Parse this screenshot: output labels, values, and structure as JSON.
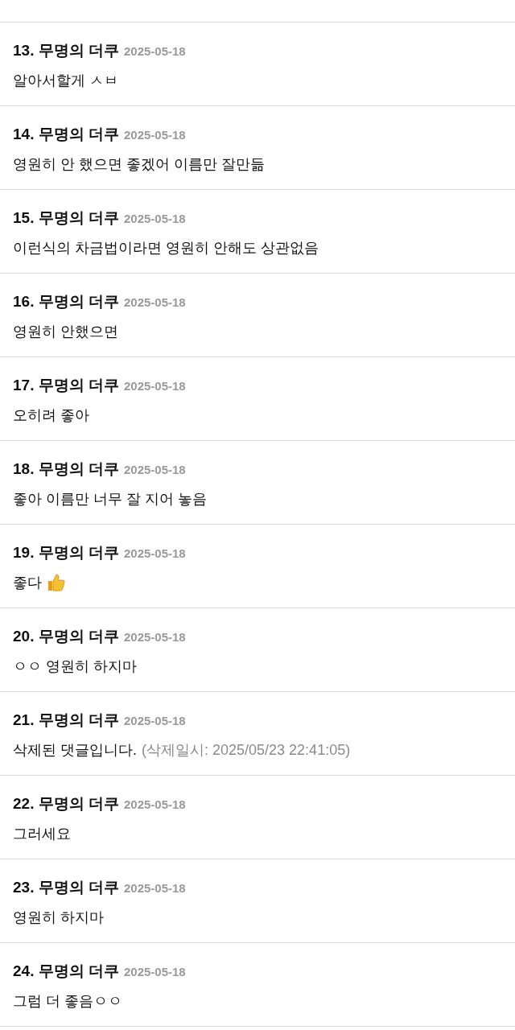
{
  "comments": [
    {
      "number": "13.",
      "author": "무명의 더쿠",
      "date": "2025-05-18",
      "text": "알아서할게 ㅅㅂ"
    },
    {
      "number": "14.",
      "author": "무명의 더쿠",
      "date": "2025-05-18",
      "text": "영원히 안 했으면 좋겠어 이름만 잘만듦"
    },
    {
      "number": "15.",
      "author": "무명의 더쿠",
      "date": "2025-05-18",
      "text": "이런식의 차금법이라면 영원히 안해도 상관없음"
    },
    {
      "number": "16.",
      "author": "무명의 더쿠",
      "date": "2025-05-18",
      "text": "영원히 안했으면"
    },
    {
      "number": "17.",
      "author": "무명의 더쿠",
      "date": "2025-05-18",
      "text": "오히려 좋아"
    },
    {
      "number": "18.",
      "author": "무명의 더쿠",
      "date": "2025-05-18",
      "text": "좋아 이름만 너무 잘 지어 놓음"
    },
    {
      "number": "19.",
      "author": "무명의 더쿠",
      "date": "2025-05-18",
      "text": "좋다",
      "thumbs_up": true
    },
    {
      "number": "20.",
      "author": "무명의 더쿠",
      "date": "2025-05-18",
      "text": "ㅇㅇ 영원히 하지마"
    },
    {
      "number": "21.",
      "author": "무명의 더쿠",
      "date": "2025-05-18",
      "text": "삭제된 댓글입니다.",
      "deleted_note": "(삭제일시: 2025/05/23 22:41:05)"
    },
    {
      "number": "22.",
      "author": "무명의 더쿠",
      "date": "2025-05-18",
      "text": "그러세요"
    },
    {
      "number": "23.",
      "author": "무명의 더쿠",
      "date": "2025-05-18",
      "text": "영원히 하지마"
    },
    {
      "number": "24.",
      "author": "무명의 더쿠",
      "date": "2025-05-18",
      "text": "그럼 더 좋음ㅇㅇ"
    }
  ]
}
